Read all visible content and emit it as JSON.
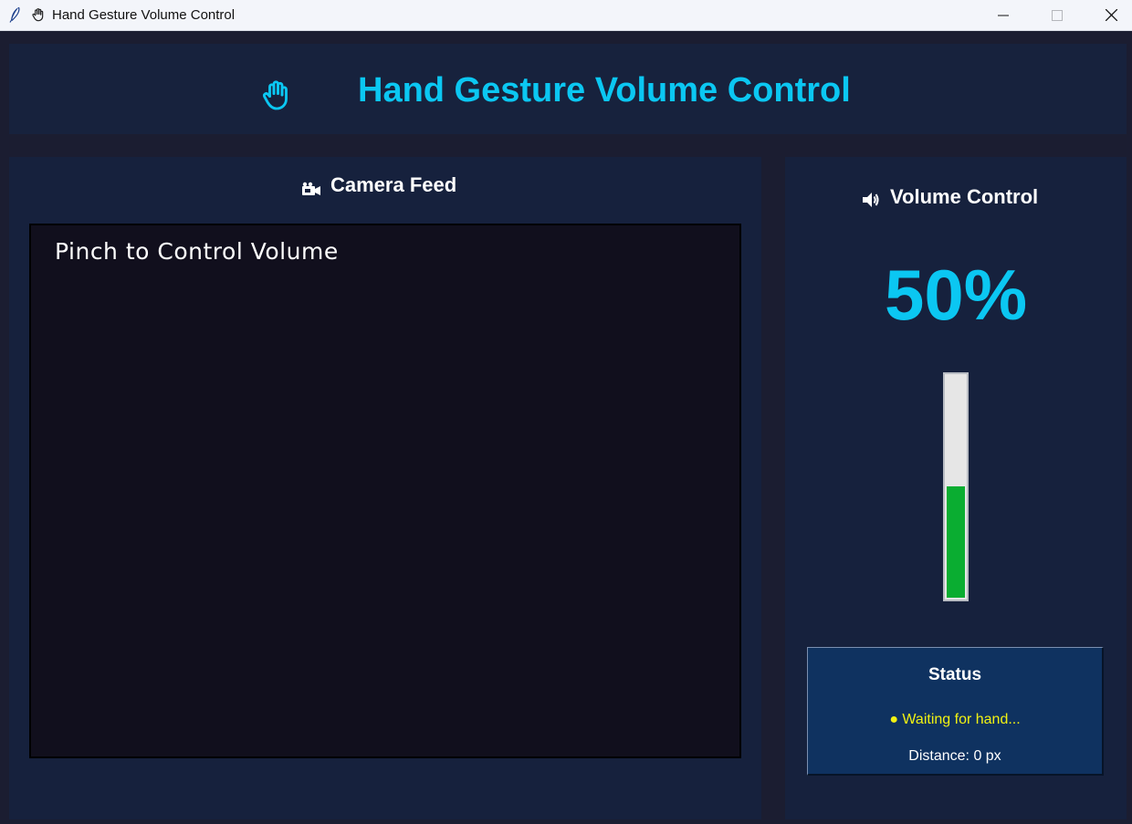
{
  "window": {
    "title": "Hand Gesture Volume Control",
    "app_icon": "feather-icon",
    "title_icon": "raised-hand-icon",
    "controls": [
      "minimize",
      "maximize",
      "close"
    ]
  },
  "header": {
    "icon": "raised-hand-icon",
    "title": "Hand Gesture Volume Control"
  },
  "camera": {
    "icon": "video-camera-icon",
    "heading": "Camera Feed",
    "overlay_text": "Pinch to Control Volume"
  },
  "volume": {
    "icon": "speaker-icon",
    "heading": "Volume Control",
    "percent_label": "50%",
    "level_percent": 50
  },
  "status": {
    "title": "Status",
    "message": "● Waiting for hand...",
    "distance_label": "Distance: 0 px"
  },
  "colors": {
    "accent": "#0bc7f2",
    "background": "#1b1d31",
    "panel": "#16213d",
    "status_box": "#0f3260",
    "status_waiting": "#f2f212",
    "volume_fill": "#0aad31"
  }
}
